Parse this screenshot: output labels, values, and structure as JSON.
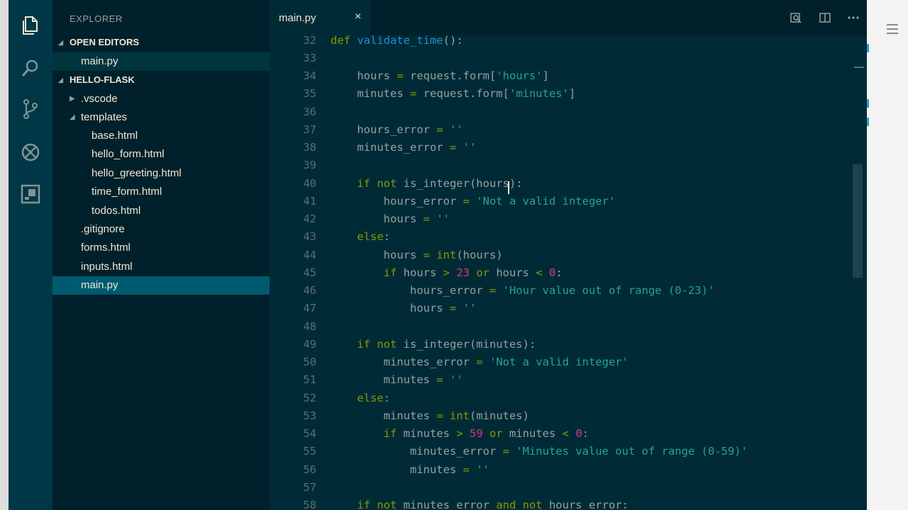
{
  "sidebar": {
    "title": "EXPLORER",
    "open_editors_label": "OPEN EDITORS",
    "open_editors": [
      {
        "label": "main.py"
      }
    ],
    "project_label": "HELLO-FLASK",
    "tree": [
      {
        "label": ".vscode"
      },
      {
        "label": "templates"
      },
      {
        "label": "base.html"
      },
      {
        "label": "hello_form.html"
      },
      {
        "label": "hello_greeting.html"
      },
      {
        "label": "time_form.html"
      },
      {
        "label": "todos.html"
      },
      {
        "label": ".gitignore"
      },
      {
        "label": "forms.html"
      },
      {
        "label": "inputs.html"
      },
      {
        "label": "main.py"
      }
    ]
  },
  "tab": {
    "label": "main.py",
    "close_glyph": "×"
  },
  "editor": {
    "lines": [
      {
        "n": "32",
        "code": [
          {
            "t": "kw",
            "s": "def "
          },
          {
            "t": "fn",
            "s": "validate_time"
          },
          {
            "t": "p",
            "s": "():"
          }
        ]
      },
      {
        "n": "33",
        "code": []
      },
      {
        "n": "34",
        "code": [
          {
            "t": "p",
            "s": "    hours "
          },
          {
            "t": "op",
            "s": "="
          },
          {
            "t": "p",
            "s": " request.form["
          },
          {
            "t": "str",
            "s": "'hours'"
          },
          {
            "t": "p",
            "s": "]"
          }
        ]
      },
      {
        "n": "35",
        "code": [
          {
            "t": "p",
            "s": "    minutes "
          },
          {
            "t": "op",
            "s": "="
          },
          {
            "t": "p",
            "s": " request.form["
          },
          {
            "t": "str",
            "s": "'minutes'"
          },
          {
            "t": "p",
            "s": "]"
          }
        ]
      },
      {
        "n": "36",
        "code": []
      },
      {
        "n": "37",
        "code": [
          {
            "t": "p",
            "s": "    hours_error "
          },
          {
            "t": "op",
            "s": "="
          },
          {
            "t": "str",
            "s": " ''"
          }
        ]
      },
      {
        "n": "38",
        "code": [
          {
            "t": "p",
            "s": "    minutes_error "
          },
          {
            "t": "op",
            "s": "="
          },
          {
            "t": "str",
            "s": " ''"
          }
        ]
      },
      {
        "n": "39",
        "code": []
      },
      {
        "n": "40",
        "code": [
          {
            "t": "kw",
            "s": "    if not "
          },
          {
            "t": "p",
            "s": "is_integer(hours):"
          }
        ]
      },
      {
        "n": "41",
        "code": [
          {
            "t": "p",
            "s": "        hours_error "
          },
          {
            "t": "op",
            "s": "="
          },
          {
            "t": "str",
            "s": " 'Not a valid integer'"
          }
        ]
      },
      {
        "n": "42",
        "code": [
          {
            "t": "p",
            "s": "        hours "
          },
          {
            "t": "op",
            "s": "="
          },
          {
            "t": "str",
            "s": " ''"
          }
        ]
      },
      {
        "n": "43",
        "code": [
          {
            "t": "kw",
            "s": "    else"
          },
          {
            "t": "p",
            "s": ":"
          }
        ]
      },
      {
        "n": "44",
        "code": [
          {
            "t": "p",
            "s": "        hours "
          },
          {
            "t": "op",
            "s": "="
          },
          {
            "t": "p",
            "s": " "
          },
          {
            "t": "kw",
            "s": "int"
          },
          {
            "t": "p",
            "s": "(hours)"
          }
        ]
      },
      {
        "n": "45",
        "code": [
          {
            "t": "kw",
            "s": "        if "
          },
          {
            "t": "p",
            "s": "hours "
          },
          {
            "t": "op",
            "s": ">"
          },
          {
            "t": "p",
            "s": " "
          },
          {
            "t": "num",
            "s": "23"
          },
          {
            "t": "kw",
            "s": " or "
          },
          {
            "t": "p",
            "s": "hours "
          },
          {
            "t": "op",
            "s": "<"
          },
          {
            "t": "p",
            "s": " "
          },
          {
            "t": "num",
            "s": "0"
          },
          {
            "t": "p",
            "s": ":"
          }
        ]
      },
      {
        "n": "46",
        "code": [
          {
            "t": "p",
            "s": "            hours_error "
          },
          {
            "t": "op",
            "s": "="
          },
          {
            "t": "str",
            "s": " 'Hour value out of range (0-23)'"
          }
        ]
      },
      {
        "n": "47",
        "code": [
          {
            "t": "p",
            "s": "            hours "
          },
          {
            "t": "op",
            "s": "="
          },
          {
            "t": "str",
            "s": " ''"
          }
        ]
      },
      {
        "n": "48",
        "code": []
      },
      {
        "n": "49",
        "code": [
          {
            "t": "kw",
            "s": "    if not "
          },
          {
            "t": "p",
            "s": "is_integer(minutes):"
          }
        ]
      },
      {
        "n": "50",
        "code": [
          {
            "t": "p",
            "s": "        minutes_error "
          },
          {
            "t": "op",
            "s": "="
          },
          {
            "t": "str",
            "s": " 'Not a valid integer'"
          }
        ]
      },
      {
        "n": "51",
        "code": [
          {
            "t": "p",
            "s": "        minutes "
          },
          {
            "t": "op",
            "s": "="
          },
          {
            "t": "str",
            "s": " ''"
          }
        ]
      },
      {
        "n": "52",
        "code": [
          {
            "t": "kw",
            "s": "    else"
          },
          {
            "t": "p",
            "s": ":"
          }
        ]
      },
      {
        "n": "53",
        "code": [
          {
            "t": "p",
            "s": "        minutes "
          },
          {
            "t": "op",
            "s": "="
          },
          {
            "t": "p",
            "s": " "
          },
          {
            "t": "kw",
            "s": "int"
          },
          {
            "t": "p",
            "s": "(minutes)"
          }
        ]
      },
      {
        "n": "54",
        "code": [
          {
            "t": "kw",
            "s": "        if "
          },
          {
            "t": "p",
            "s": "minutes "
          },
          {
            "t": "op",
            "s": ">"
          },
          {
            "t": "p",
            "s": " "
          },
          {
            "t": "num",
            "s": "59"
          },
          {
            "t": "kw",
            "s": " or "
          },
          {
            "t": "p",
            "s": "minutes "
          },
          {
            "t": "op",
            "s": "<"
          },
          {
            "t": "p",
            "s": " "
          },
          {
            "t": "num",
            "s": "0"
          },
          {
            "t": "p",
            "s": ":"
          }
        ]
      },
      {
        "n": "55",
        "code": [
          {
            "t": "p",
            "s": "            minutes_error "
          },
          {
            "t": "op",
            "s": "="
          },
          {
            "t": "str",
            "s": " 'Minutes value out of range (0-59)'"
          }
        ]
      },
      {
        "n": "56",
        "code": [
          {
            "t": "p",
            "s": "            minutes "
          },
          {
            "t": "op",
            "s": "="
          },
          {
            "t": "str",
            "s": " ''"
          }
        ]
      },
      {
        "n": "57",
        "code": []
      },
      {
        "n": "58",
        "code": [
          {
            "t": "kw",
            "s": "    if not "
          },
          {
            "t": "p",
            "s": "minutes_error "
          },
          {
            "t": "kw",
            "s": "and not "
          },
          {
            "t": "p",
            "s": "hours_error:"
          }
        ]
      }
    ]
  },
  "colors": {
    "editor_bg": "#002b36",
    "sidebar_bg": "#00212b",
    "activity_bg": "#003847",
    "keyword": "#859900",
    "string": "#2aa198",
    "number": "#d33682",
    "function": "#268bd2",
    "selection": "#005a6f"
  },
  "icons": [
    "files-icon",
    "search-icon",
    "source-control-icon",
    "debug-icon",
    "extensions-icon",
    "open-preview-icon",
    "split-editor-icon",
    "more-actions-icon"
  ]
}
